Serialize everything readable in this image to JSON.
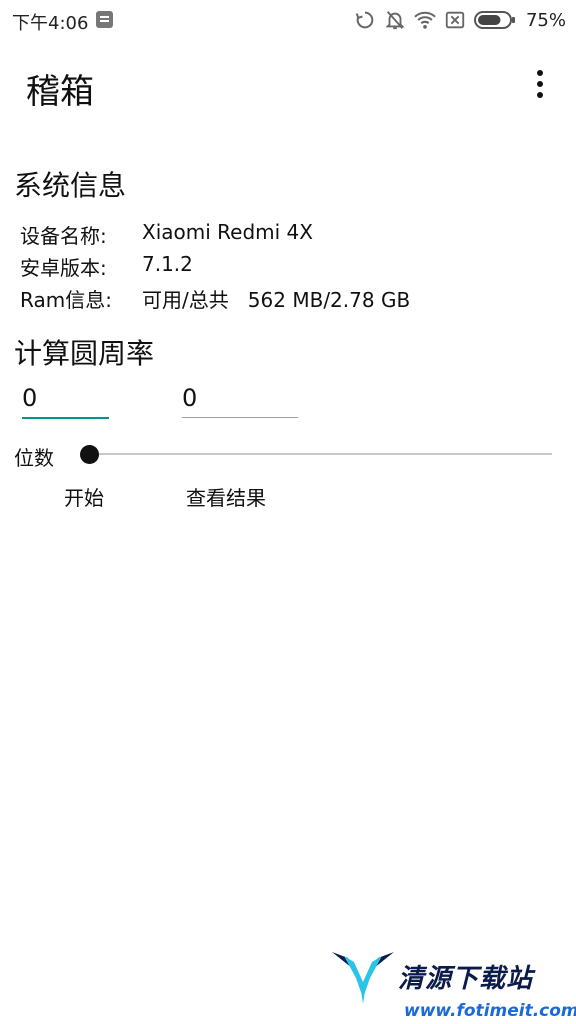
{
  "status_bar": {
    "time": "下午4:06",
    "battery_percent": "75%",
    "battery_level": 0.75,
    "icons": [
      "note-icon",
      "sync-icon",
      "bell-off-icon",
      "wifi-icon",
      "sim-x-icon",
      "battery-icon"
    ]
  },
  "app_bar": {
    "title": "稽箱",
    "overflow_icon": "more-vertical-icon"
  },
  "system_info": {
    "title": "系统信息",
    "rows": [
      {
        "label": "设备名称:",
        "value": "Xiaomi Redmi 4X"
      },
      {
        "label": "安卓版本:",
        "value": "7.1.2"
      },
      {
        "label": "Ram信息:",
        "value": "可用/总共   562 MB/2.78 GB"
      }
    ]
  },
  "pi_calc": {
    "title": "计算圆周率",
    "input1_value": "0",
    "input2_value": "0",
    "digits_label": "位数",
    "slider_value": 0,
    "start_label": "开始",
    "result_label": "查看结果"
  },
  "watermark": {
    "title": "清源下载站",
    "url": "www.fotimeit.com"
  },
  "colors": {
    "accent": "#009688",
    "input_line": "#9e9e9e",
    "track": "#c8c8c8"
  }
}
